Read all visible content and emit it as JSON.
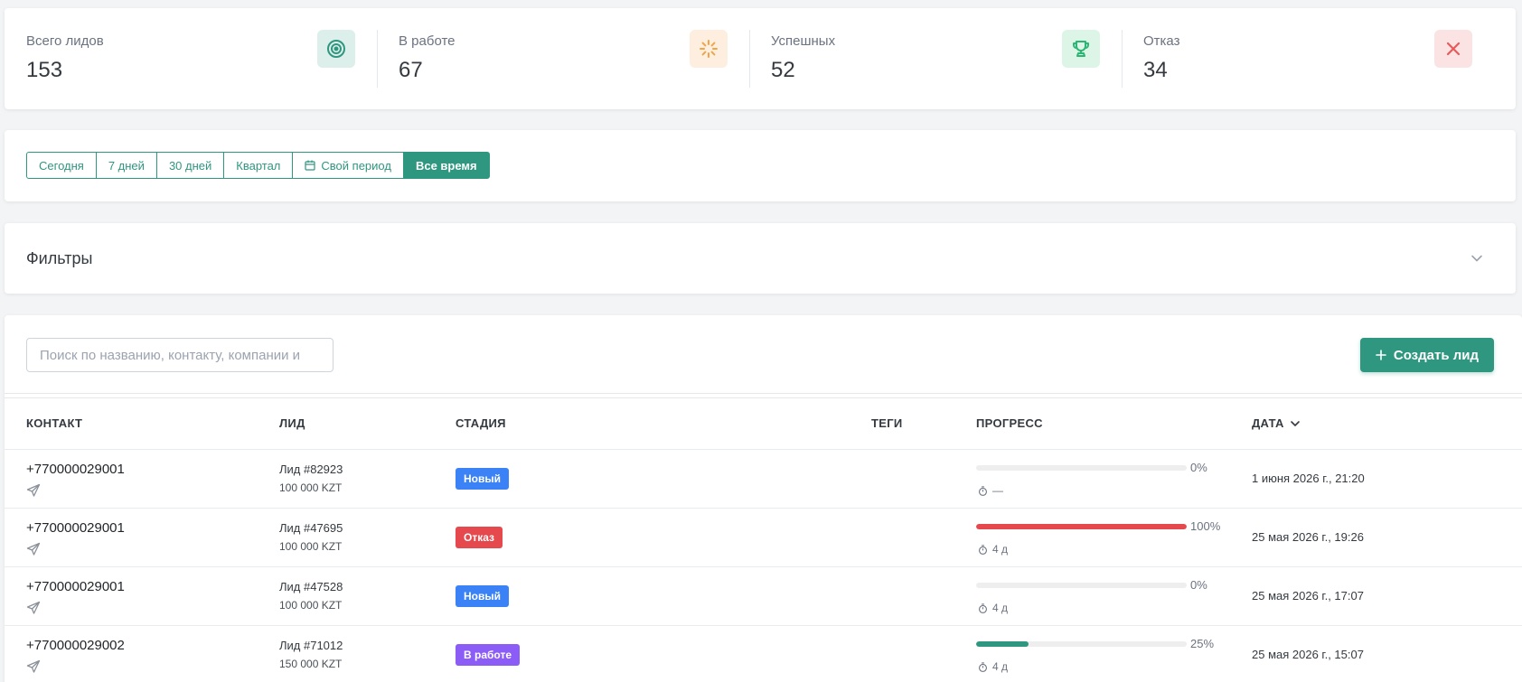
{
  "stats": [
    {
      "label": "Всего лидов",
      "value": "153",
      "icon": "target-icon",
      "icon_bg": "#dcefeb",
      "icon_color": "#2f9680"
    },
    {
      "label": "В работе",
      "value": "67",
      "icon": "loader-icon",
      "icon_bg": "#fdeee0",
      "icon_color": "#f2a444"
    },
    {
      "label": "Успешных",
      "value": "52",
      "icon": "trophy-icon",
      "icon_bg": "#dcf5e6",
      "icon_color": "#2bb673"
    },
    {
      "label": "Отказ",
      "value": "34",
      "icon": "close-icon",
      "icon_bg": "#fbe3e3",
      "icon_color": "#e85a5a"
    }
  ],
  "periods": {
    "today": "Сегодня",
    "days7": "7 дней",
    "days30": "30 дней",
    "quarter": "Квартал",
    "custom": "Свой период",
    "all": "Все время",
    "active": "Все время"
  },
  "filters": {
    "title": "Фильтры",
    "expanded": false
  },
  "toolbar": {
    "search_placeholder": "Поиск по названию, контакту, компании и",
    "search_value": "",
    "create_label": "Создать лид"
  },
  "table": {
    "headers": {
      "contact": "КОНТАКТ",
      "lead": "ЛИД",
      "stage": "СТАДИЯ",
      "tags": "ТЕГИ",
      "progress": "ПРОГРЕСС",
      "date": "ДАТА"
    },
    "sort": {
      "column": "date",
      "direction": "desc"
    },
    "rows": [
      {
        "contact": "+770000029001",
        "lead": "Лид #82923",
        "amount": "100 000 KZT",
        "stage": "Новый",
        "stage_color": "#3b82f6",
        "progress": 0,
        "progress_label": "0%",
        "progress_color": "#e5484d",
        "time": "—",
        "date": "1 июня 2026 г., 21:20"
      },
      {
        "contact": "+770000029001",
        "lead": "Лид #47695",
        "amount": "100 000 KZT",
        "stage": "Отказ",
        "stage_color": "#e5484d",
        "progress": 100,
        "progress_label": "100%",
        "progress_color": "#e5484d",
        "time": "4 д",
        "date": "25 мая 2026 г., 19:26"
      },
      {
        "contact": "+770000029001",
        "lead": "Лид #47528",
        "amount": "100 000 KZT",
        "stage": "Новый",
        "stage_color": "#3b82f6",
        "progress": 0,
        "progress_label": "0%",
        "progress_color": "#e5484d",
        "time": "4 д",
        "date": "25 мая 2026 г., 17:07"
      },
      {
        "contact": "+770000029002",
        "lead": "Лид #71012",
        "amount": "150 000 KZT",
        "stage": "В работе",
        "stage_color": "#8b5cf6",
        "progress": 25,
        "progress_label": "25%",
        "progress_color": "#2f9680",
        "time": "4 д",
        "date": "25 мая 2026 г., 15:07"
      }
    ]
  }
}
